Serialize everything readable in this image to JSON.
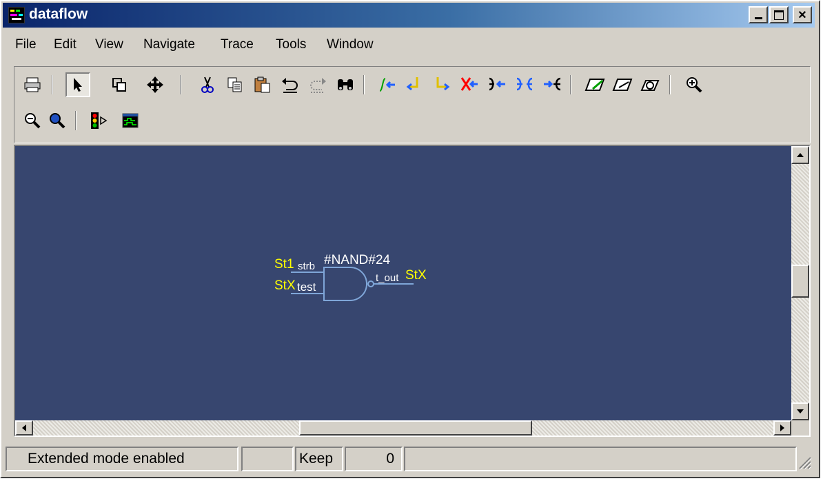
{
  "window": {
    "title": "dataflow",
    "controls": {
      "minimize": "_",
      "maximize": "□",
      "close": "✕"
    }
  },
  "menu": [
    "File",
    "Edit",
    "View",
    "Navigate",
    "Trace",
    "Tools",
    "Window"
  ],
  "toolbar": {
    "icons": [
      "print-icon",
      "select-pointer-icon",
      "zoom-area-icon",
      "pan-icon",
      "cut-icon",
      "copy-icon",
      "paste-icon",
      "undo-icon",
      "redo-icon",
      "find-icon",
      "trace-input-icon",
      "trace-input-back-icon",
      "trace-output-icon",
      "trace-cancel-icon",
      "expand-input-icon",
      "expand-both-icon",
      "expand-output-icon",
      "erase-icon",
      "erase-all-icon",
      "regenerate-icon",
      "zoom-in-icon",
      "zoom-out-icon",
      "zoom-full-icon",
      "traffic-light-icon",
      "wave-window-icon"
    ],
    "selected": "select-pointer-icon"
  },
  "canvas": {
    "background": "#37466f",
    "gate": {
      "instance": "#NAND#24",
      "inputs": [
        {
          "value": "St1",
          "port": "strb"
        },
        {
          "value": "StX",
          "port": "test"
        }
      ],
      "output": {
        "port": "t_out",
        "value": "StX"
      }
    },
    "colors": {
      "value": "#ffff00",
      "label": "#ffffff",
      "wire": "#7fa6d8"
    }
  },
  "status": {
    "mode": "Extended mode enabled",
    "keep_label": "Keep",
    "count": "0"
  }
}
